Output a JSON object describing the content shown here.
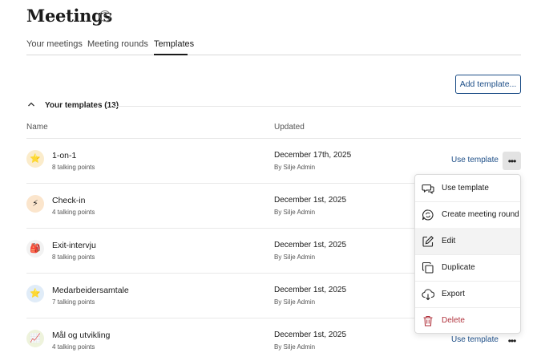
{
  "page": {
    "title": "Meetings",
    "help_icon_glyph": "?"
  },
  "tabs": [
    {
      "label": "Your meetings",
      "active": false
    },
    {
      "label": "Meeting rounds",
      "active": false
    },
    {
      "label": "Templates",
      "active": true
    }
  ],
  "toolbar": {
    "add_template_label": "Add template..."
  },
  "section": {
    "title": "Your templates (13)",
    "expanded": true
  },
  "table": {
    "columns": [
      "Name",
      "Updated"
    ],
    "rows": [
      {
        "name": "1-on-1",
        "talking_points": "8 talking points",
        "updated": "December 17th, 2025",
        "by": "By Silje Admin",
        "avatar_emoji": "⭐",
        "avatar_bg": "#fbeccb",
        "use_label": "Use template",
        "show_use": true,
        "menu_open": true
      },
      {
        "name": "Check-in",
        "talking_points": "4 talking points",
        "updated": "December 1st, 2025",
        "by": "By Silje Admin",
        "avatar_emoji": "⚡",
        "avatar_bg": "#fbe5cc",
        "use_label": "",
        "show_use": false,
        "menu_open": false
      },
      {
        "name": "Exit-intervju",
        "talking_points": "8 talking points",
        "updated": "December 1st, 2025",
        "by": "By Silje Admin",
        "avatar_emoji": "🎒",
        "avatar_bg": "#f2f2f2",
        "use_label": "",
        "show_use": false,
        "menu_open": false
      },
      {
        "name": "Medarbeidersamtale",
        "talking_points": "7 talking points",
        "updated": "December 1st, 2025",
        "by": "By Silje Admin",
        "avatar_emoji": "⭐",
        "avatar_bg": "#e0ecf8",
        "use_label": "",
        "show_use": false,
        "menu_open": false
      },
      {
        "name": "Mål og utvikling",
        "talking_points": "4 talking points",
        "updated": "December 1st, 2025",
        "by": "By Silje Admin",
        "avatar_emoji": "📈",
        "avatar_bg": "#eef3dc",
        "use_label": "Use template",
        "show_use": true,
        "menu_open": false
      }
    ]
  },
  "context_menu": {
    "items": [
      {
        "label": "Use template",
        "icon": "chat-bubbles-icon",
        "danger": false,
        "hover": false
      },
      {
        "label": "Create meeting round",
        "icon": "chat-refresh-icon",
        "danger": false,
        "hover": false
      },
      {
        "label": "Edit",
        "icon": "edit-pencil-icon",
        "danger": false,
        "hover": true
      },
      {
        "label": "Duplicate",
        "icon": "duplicate-icon",
        "danger": false,
        "hover": false
      },
      {
        "label": "Export",
        "icon": "export-cloud-icon",
        "danger": false,
        "hover": false
      },
      {
        "label": "Delete",
        "icon": "trash-icon",
        "danger": true,
        "hover": false
      }
    ]
  },
  "colors": {
    "accent": "#1e4f88",
    "danger": "#b0323c",
    "menu_button_active_bg": "#e3e3e3"
  }
}
